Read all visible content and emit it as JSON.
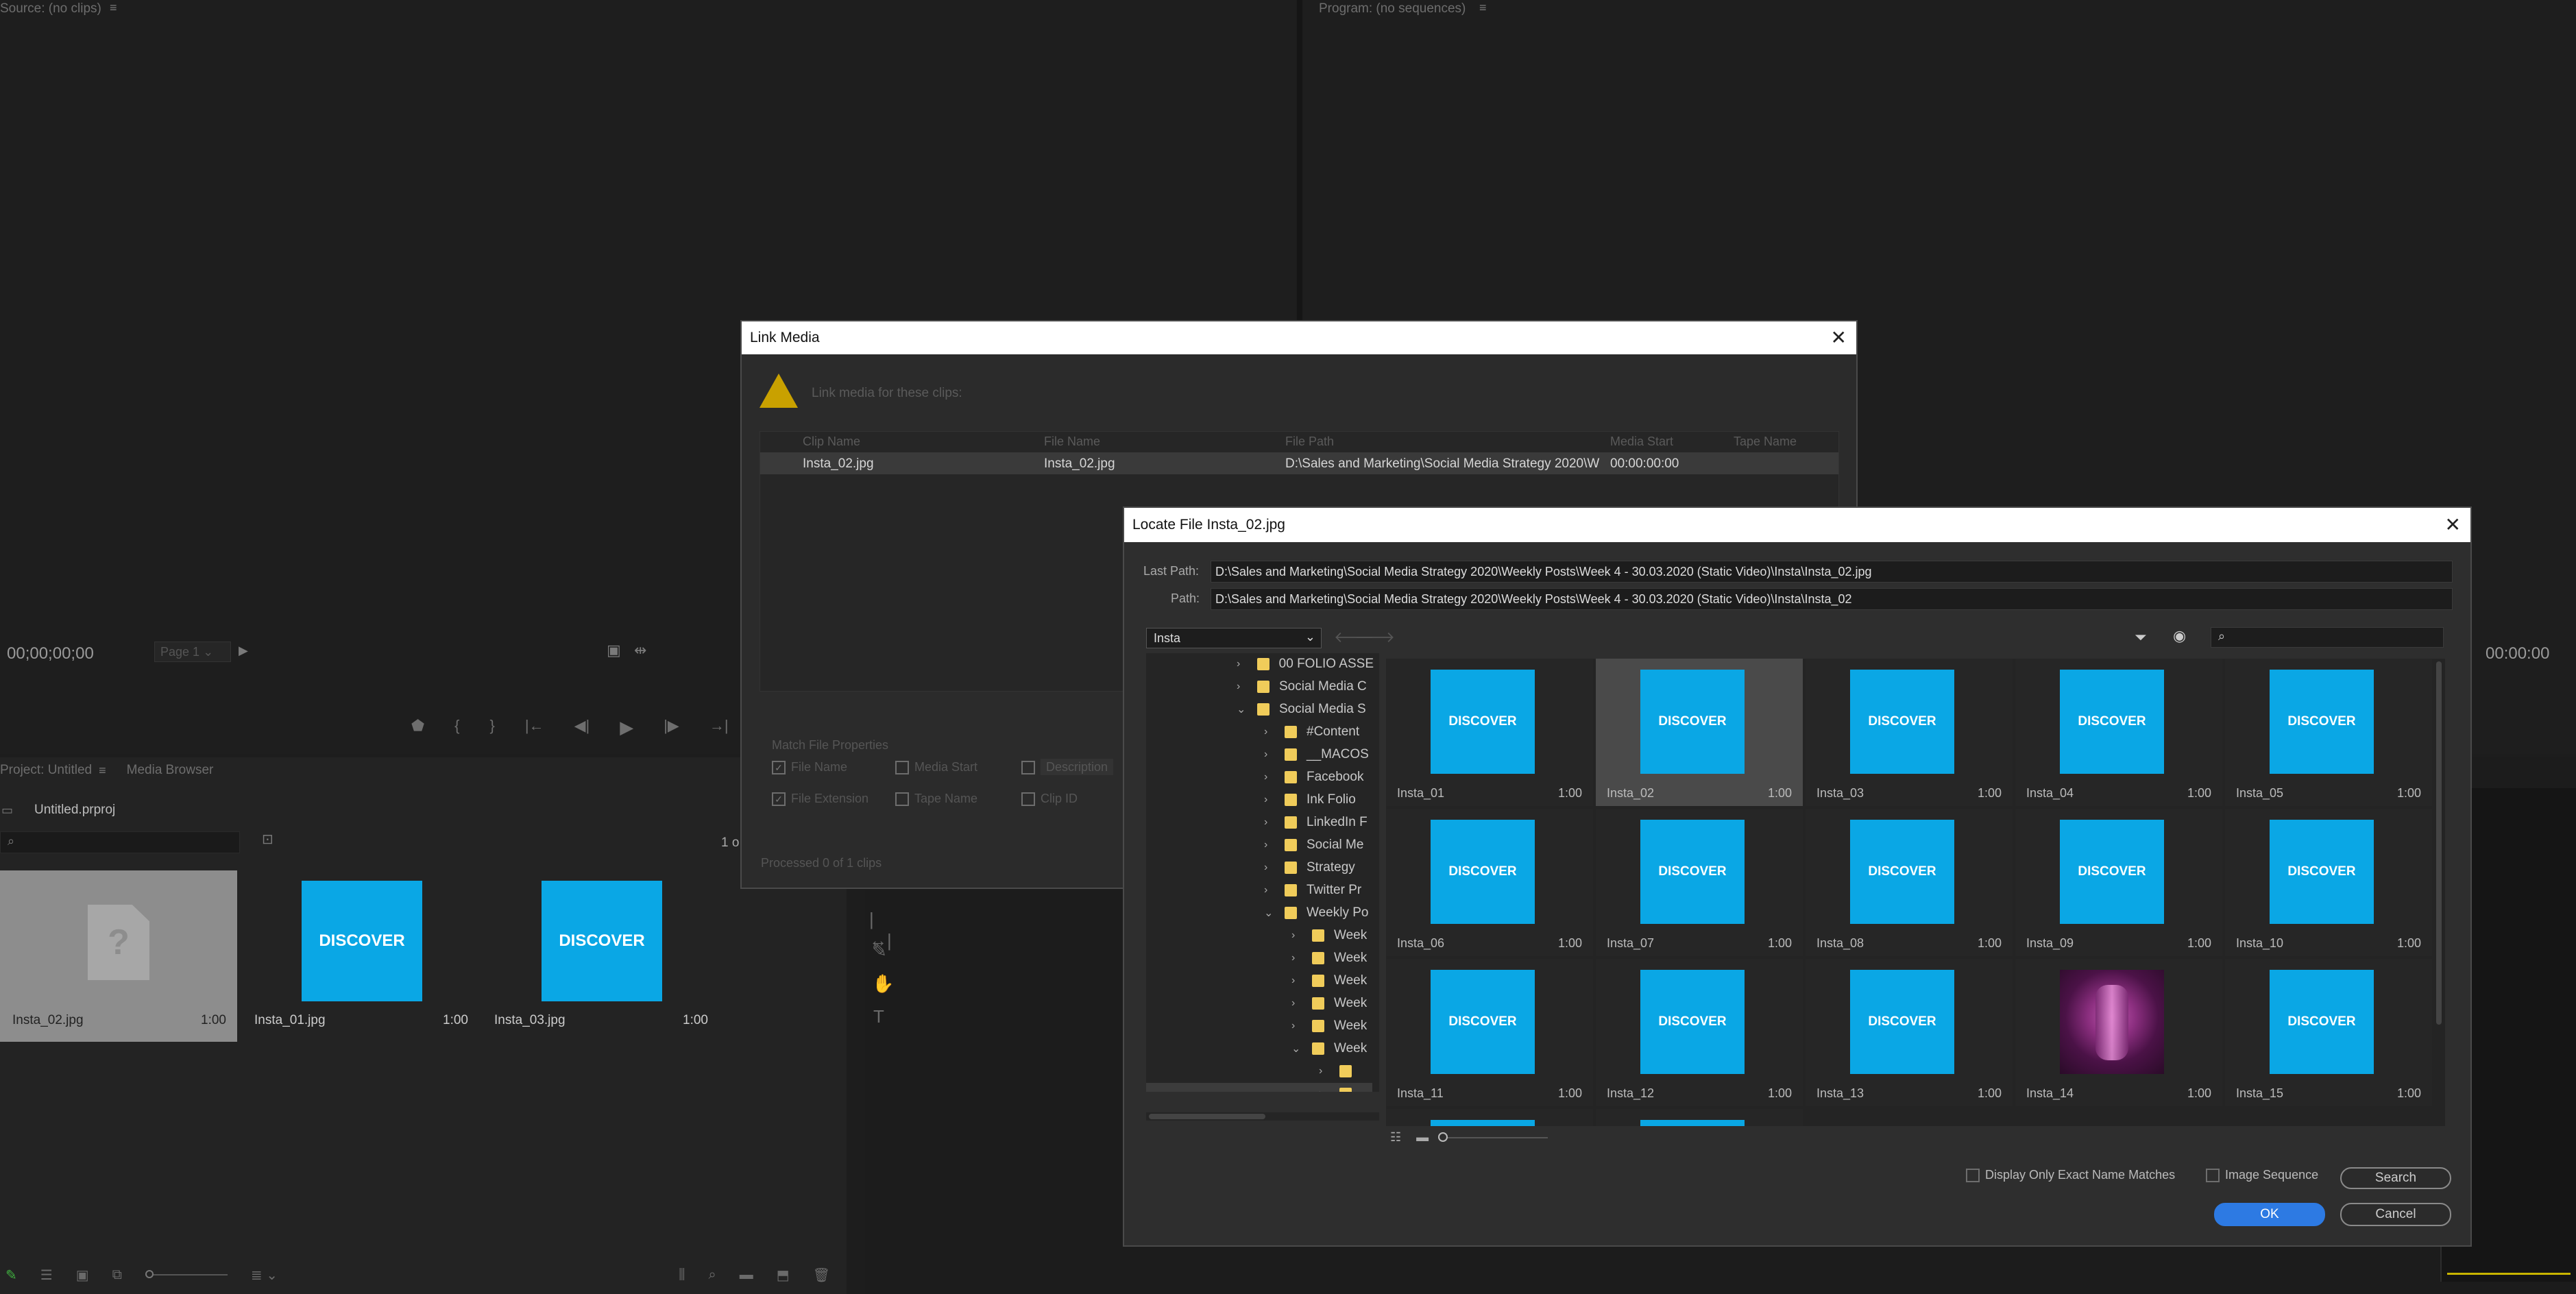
{
  "source_monitor": {
    "title": "Source: (no clips)",
    "timecode": "00;00;00;00",
    "page": "Page 1"
  },
  "program_monitor": {
    "title": "Program: (no sequences)",
    "timecode": "00:00:00"
  },
  "project_panel": {
    "tab_project": "Project: Untitled",
    "tab_media_browser": "Media Browser",
    "project_file": "Untitled.prproj",
    "count": "1 o",
    "items": [
      {
        "name": "Insta_02.jpg",
        "duration": "1:00",
        "offline": true
      },
      {
        "name": "Insta_01.jpg",
        "duration": "1:00",
        "label": "DISCOVER"
      },
      {
        "name": "Insta_03.jpg",
        "duration": "1:00",
        "label": "DISCOVER"
      }
    ]
  },
  "link_media": {
    "title": "Link Media",
    "message": "Link media for these clips:",
    "columns": [
      "Clip Name",
      "File Name",
      "File Path",
      "Media Start",
      "Tape Name"
    ],
    "row": {
      "clip_name": "Insta_02.jpg",
      "file_name": "Insta_02.jpg",
      "file_path": "D:\\Sales and Marketing\\Social Media Strategy 2020\\W",
      "media_start": "00:00:00:00"
    },
    "match_title": "Match File Properties",
    "match_options": [
      "File Name",
      "Media Start",
      "Description",
      "File Extension",
      "Tape Name",
      "Clip ID"
    ],
    "processed": "Processed 0 of 1 clips"
  },
  "locate_file": {
    "title": "Locate File Insta_02.jpg",
    "last_path_label": "Last Path:",
    "last_path": "D:\\Sales and Marketing\\Social Media Strategy 2020\\Weekly Posts\\Week 4 - 30.03.2020 (Static Video)\\Insta\\Insta_02.jpg",
    "path_label": "Path:",
    "path": "D:\\Sales and Marketing\\Social Media Strategy 2020\\Weekly Posts\\Week 4 - 30.03.2020 (Static Video)\\Insta\\Insta_02",
    "folder_select": "Insta",
    "tree": [
      "00 FOLIO ASSE",
      "Social Media C",
      "Social Media S",
      "#Content",
      "__MACOS",
      "Facebook",
      "Ink Folio",
      "LinkedIn F",
      "Social Me",
      "Strategy",
      "Twitter Pr",
      "Weekly Po",
      "Week",
      "Week",
      "Week",
      "Week",
      "Week",
      "Week"
    ],
    "thumb_label": "DISCOVER",
    "thumbs": [
      {
        "name": "Insta_01",
        "duration": "1:00"
      },
      {
        "name": "Insta_02",
        "duration": "1:00"
      },
      {
        "name": "Insta_03",
        "duration": "1:00"
      },
      {
        "name": "Insta_04",
        "duration": "1:00"
      },
      {
        "name": "Insta_05",
        "duration": "1:00"
      },
      {
        "name": "Insta_06",
        "duration": "1:00"
      },
      {
        "name": "Insta_07",
        "duration": "1:00"
      },
      {
        "name": "Insta_08",
        "duration": "1:00"
      },
      {
        "name": "Insta_09",
        "duration": "1:00"
      },
      {
        "name": "Insta_10",
        "duration": "1:00"
      },
      {
        "name": "Insta_11",
        "duration": "1:00"
      },
      {
        "name": "Insta_12",
        "duration": "1:00"
      },
      {
        "name": "Insta_13",
        "duration": "1:00"
      },
      {
        "name": "Insta_14",
        "duration": "1:00",
        "photo": true
      },
      {
        "name": "Insta_15",
        "duration": "1:00"
      }
    ],
    "exact_match_label": "Display Only Exact Name Matches",
    "image_sequence_label": "Image Sequence",
    "search_btn": "Search",
    "ok_btn": "OK",
    "cancel_btn": "Cancel"
  },
  "colors": {
    "accent": "#2d7ae3",
    "discover": "#0aa7e5",
    "folder": "#f0cc5a"
  }
}
